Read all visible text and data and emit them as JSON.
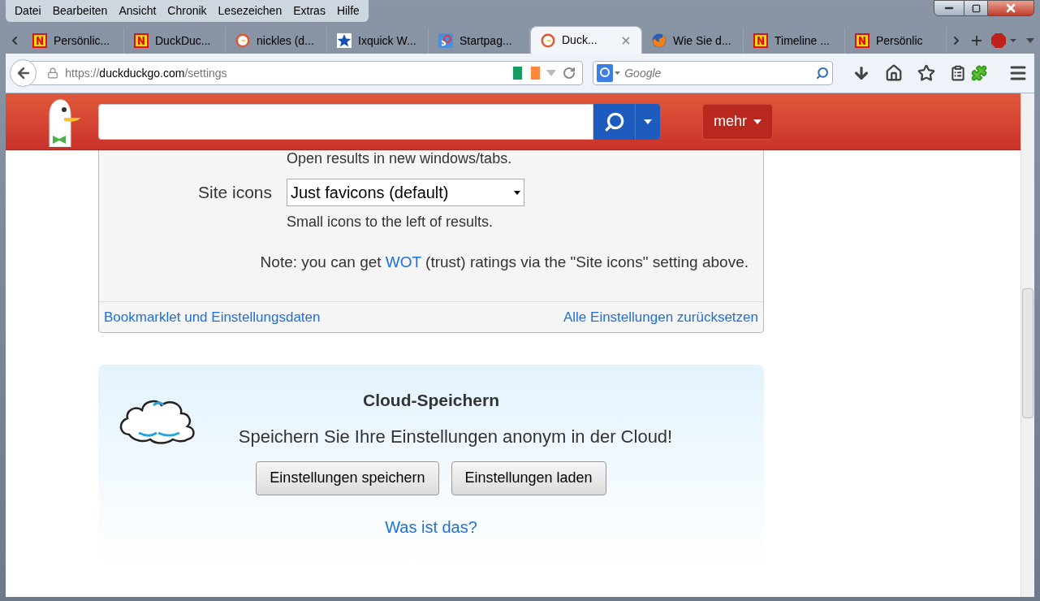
{
  "menu": [
    "Datei",
    "Bearbeiten",
    "Ansicht",
    "Chronik",
    "Lesezeichen",
    "Extras",
    "Hilfe"
  ],
  "tabs": [
    {
      "label": "Persönlic...",
      "kind": "n",
      "selected": false
    },
    {
      "label": "DuckDuc...",
      "kind": "n",
      "selected": false
    },
    {
      "label": "nickles (d...",
      "kind": "ddg",
      "selected": false
    },
    {
      "label": "Ixquick W...",
      "kind": "star",
      "selected": false
    },
    {
      "label": "Startpag...",
      "kind": "sp",
      "selected": false
    },
    {
      "label": "Duck...",
      "kind": "ddg",
      "selected": true
    },
    {
      "label": "Wie Sie d...",
      "kind": "firefox",
      "selected": false
    },
    {
      "label": "Timeline ...",
      "kind": "n",
      "selected": false
    },
    {
      "label": "Persönlic",
      "kind": "n",
      "selected": false
    }
  ],
  "url": {
    "scheme": "https://",
    "domain": "duckduckgo.com",
    "path": "/settings"
  },
  "search": {
    "placeholder": "Google"
  },
  "header": {
    "more_button": "mehr"
  },
  "settings": {
    "prev_hint": "Open results in new windows/tabs.",
    "label": "Site icons",
    "select_value": "Just favicons (default)",
    "hint": "Small icons to the left of results.",
    "note_before": "Note: you can get ",
    "note_link": "WOT",
    "note_after": " (trust) ratings via the \"Site icons\" setting above.",
    "footer_links": [
      "Bookmarklet und Einstellungsdaten",
      "Alle Einstellungen zurücksetzen"
    ]
  },
  "cloud": {
    "title": "Cloud-Speichern",
    "text": "Speichern Sie Ihre Einstellungen anonym in der Cloud!",
    "buttons": [
      "Einstellungen speichern",
      "Einstellungen laden"
    ],
    "link": "Was ist das?"
  }
}
